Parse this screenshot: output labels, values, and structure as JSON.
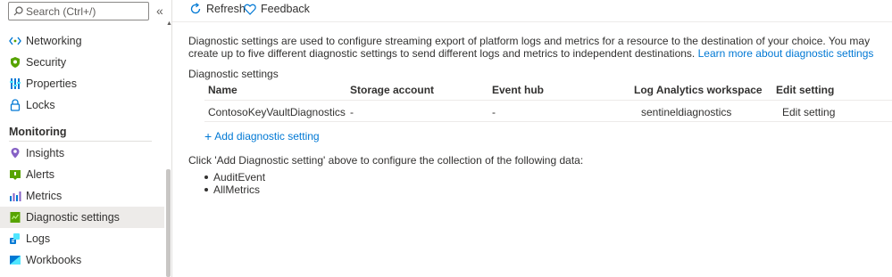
{
  "sidebar": {
    "search_placeholder": "Search (Ctrl+/)",
    "collapse_glyph": "«",
    "items_top": [
      {
        "label": "Networking",
        "icon": "networking-icon"
      },
      {
        "label": "Security",
        "icon": "security-shield-icon"
      },
      {
        "label": "Properties",
        "icon": "properties-icon"
      },
      {
        "label": "Locks",
        "icon": "lock-icon"
      }
    ],
    "monitoring_header": "Monitoring",
    "items_monitoring": [
      {
        "label": "Insights",
        "icon": "insights-icon"
      },
      {
        "label": "Alerts",
        "icon": "alerts-icon"
      },
      {
        "label": "Metrics",
        "icon": "metrics-icon"
      },
      {
        "label": "Diagnostic settings",
        "icon": "diagnostic-settings-icon",
        "selected": true
      },
      {
        "label": "Logs",
        "icon": "logs-icon"
      },
      {
        "label": "Workbooks",
        "icon": "workbooks-icon"
      }
    ]
  },
  "toolbar": {
    "refresh_label": "Refresh",
    "feedback_label": "Feedback"
  },
  "main": {
    "description": "Diagnostic settings are used to configure streaming export of platform logs and metrics for a resource to the destination of your choice. You may create up to five different diagnostic settings to send different logs and metrics to independent destinations.",
    "learn_more_link": "Learn more about diagnostic settings",
    "section_title": "Diagnostic settings",
    "table": {
      "headers": [
        "Name",
        "Storage account",
        "Event hub",
        "Log Analytics workspace",
        "Edit setting"
      ],
      "rows": [
        {
          "name": "ContosoKeyVaultDiagnostics",
          "storage_account": "-",
          "event_hub": "-",
          "workspace": "sentineldiagnostics",
          "edit": "Edit setting"
        }
      ]
    },
    "add_setting_label": "Add diagnostic setting",
    "collect_text": "Click 'Add Diagnostic setting' above to configure the collection of the following data:",
    "data_items": [
      "AuditEvent",
      "AllMetrics"
    ]
  },
  "colors": {
    "accent": "#0078d4",
    "selected_bg": "#edebe9",
    "text": "#323130"
  }
}
